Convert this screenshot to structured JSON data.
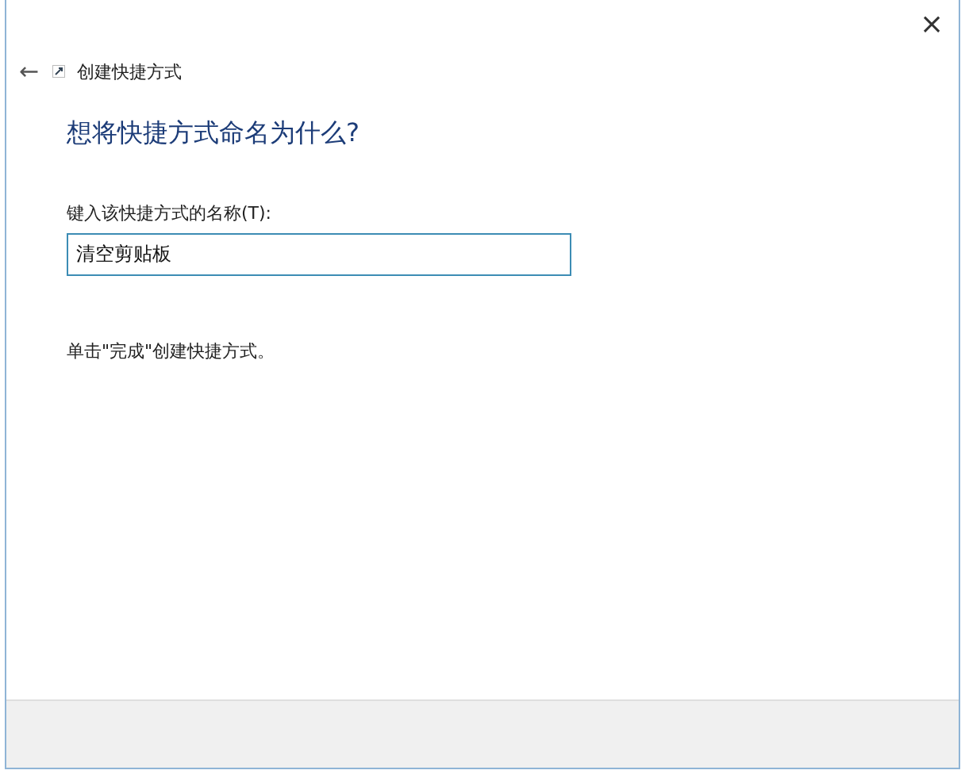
{
  "window": {
    "close": "×"
  },
  "header": {
    "back": "←",
    "title": "创建快捷方式"
  },
  "heading": "想将快捷方式命名为什么?",
  "name_field": {
    "label": "键入该快捷方式的名称(T):",
    "value": "清空剪贴板",
    "focused": true
  },
  "instruction": "单击\"完成\"创建快捷方式。"
}
